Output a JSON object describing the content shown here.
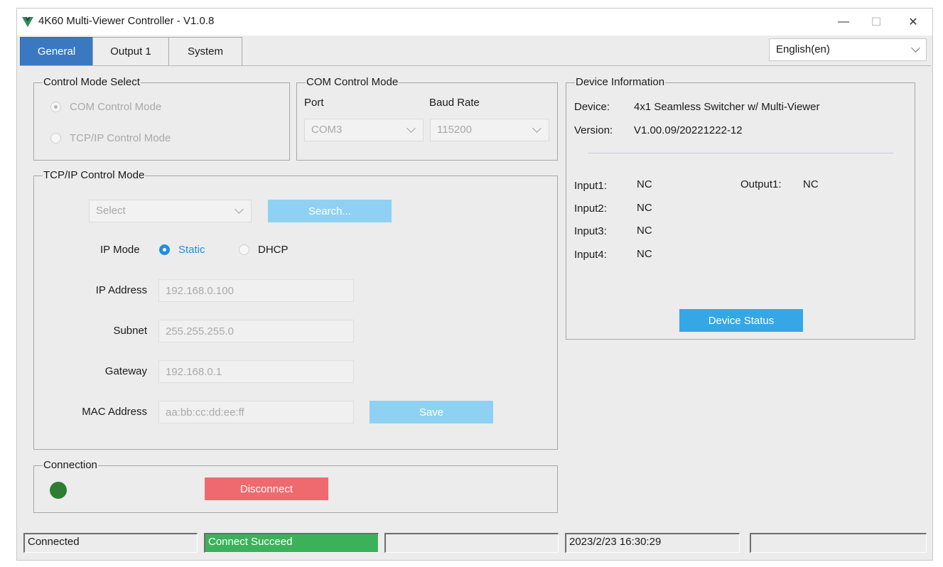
{
  "window": {
    "title": "4K60 Multi-Viewer Controller - V1.0.8",
    "minimize_glyph": "—",
    "maximize_glyph": "☐",
    "close_glyph": "✕"
  },
  "tabs": [
    {
      "label": "General",
      "active": true
    },
    {
      "label": "Output 1",
      "active": false
    },
    {
      "label": "System",
      "active": false
    }
  ],
  "language": {
    "selected": "English(en)"
  },
  "control_mode": {
    "title": "Control Mode Select",
    "options": [
      {
        "label": "COM Control Mode",
        "selected": true
      },
      {
        "label": "TCP/IP Control Mode",
        "selected": false
      }
    ]
  },
  "com_mode": {
    "title": "COM Control Mode",
    "port_label": "Port",
    "baud_label": "Baud Rate",
    "port_value": "COM3",
    "baud_value": "115200"
  },
  "tcpip": {
    "title": "TCP/IP Control Mode",
    "device_select": "Select",
    "search_label": "Search...",
    "ip_mode_label": "IP Mode",
    "ip_mode_options": [
      {
        "label": "Static",
        "selected": true
      },
      {
        "label": "DHCP",
        "selected": false
      }
    ],
    "fields": {
      "ip_address": {
        "label": "IP Address",
        "value": "192.168.0.100"
      },
      "subnet": {
        "label": "Subnet",
        "value": "255.255.255.0"
      },
      "gateway": {
        "label": "Gateway",
        "value": "192.168.0.1"
      },
      "mac_address": {
        "label": "MAC Address",
        "value": "aa:bb:cc:dd:ee:ff"
      }
    },
    "save_label": "Save"
  },
  "connection": {
    "title": "Connection",
    "led_color": "#2e7d32",
    "disconnect_label": "Disconnect"
  },
  "device_info": {
    "title": "Device Information",
    "device_label": "Device:",
    "device_value": "4x1 Seamless Switcher w/ Multi-Viewer",
    "version_label": "Version:",
    "version_value": "V1.00.09/20221222-12",
    "inputs": [
      {
        "label": "Input1:",
        "value": "NC"
      },
      {
        "label": "Input2:",
        "value": "NC"
      },
      {
        "label": "Input3:",
        "value": "NC"
      },
      {
        "label": "Input4:",
        "value": "NC"
      }
    ],
    "output1": {
      "label": "Output1:",
      "value": "NC"
    },
    "status_button": "Device Status"
  },
  "statusbar": {
    "state": "Connected",
    "message": "Connect Succeed",
    "empty1": "",
    "datetime": "2023/2/23 16:30:29",
    "empty2": ""
  },
  "colors": {
    "accent": "#3b78c2",
    "button_blue": "#35a7e6",
    "button_light_blue": "#8ed1f3",
    "button_red": "#ee6a6e",
    "status_green": "#3bb25a"
  }
}
